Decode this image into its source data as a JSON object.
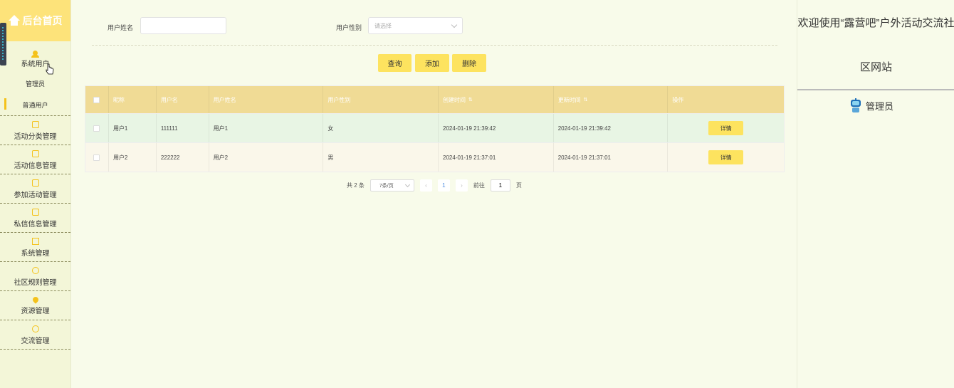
{
  "sidebar": {
    "title": "后台首页",
    "items": [
      {
        "label": "系统用户",
        "icon": "user-icon"
      },
      {
        "label": "活动分类管理",
        "icon": "document-icon"
      },
      {
        "label": "活动信息管理",
        "icon": "document-icon"
      },
      {
        "label": "参加活动管理",
        "icon": "document-icon"
      },
      {
        "label": "私信信息管理",
        "icon": "document-icon"
      },
      {
        "label": "系统管理",
        "icon": "image-icon"
      },
      {
        "label": "社区规则管理",
        "icon": "info-icon"
      },
      {
        "label": "资源管理",
        "icon": "pin-icon"
      },
      {
        "label": "交流管理",
        "icon": "chat-icon"
      }
    ],
    "sub_items": [
      {
        "label": "管理员",
        "active": false
      },
      {
        "label": "普通用户",
        "active": true
      }
    ]
  },
  "filters": {
    "name_label": "用户姓名",
    "name_value": "",
    "gender_label": "用户性别",
    "gender_placeholder": "请选择"
  },
  "actions": {
    "query": "查询",
    "add": "添加",
    "delete": "删除"
  },
  "table": {
    "headers": [
      "昵称",
      "用户名",
      "用户姓名",
      "用户性别",
      "创建时间",
      "更新时间",
      "操作"
    ],
    "rows": [
      {
        "nickname": "用户1",
        "username": "111111",
        "realname": "用户1",
        "gender": "女",
        "created": "2024-01-19 21:39:42",
        "updated": "2024-01-19 21:39:42",
        "action": "详情"
      },
      {
        "nickname": "用户2",
        "username": "222222",
        "realname": "用户2",
        "gender": "男",
        "created": "2024-01-19 21:37:01",
        "updated": "2024-01-19 21:37:01",
        "action": "详情"
      }
    ]
  },
  "pagination": {
    "total": "共 2 条",
    "page_size": "7条/页",
    "current_page": "1",
    "goto_label": "前往",
    "goto_value": "1",
    "page_unit": "页"
  },
  "right_panel": {
    "welcome_line1": "欢迎使用“露营吧”户外活动交流社",
    "welcome_line2": "区网站",
    "role": "管理员"
  },
  "colors": {
    "accent": "#fde35f",
    "header": "#f0db95",
    "sidebar_head": "#fde37a",
    "active_marker": "#f4c21b"
  }
}
